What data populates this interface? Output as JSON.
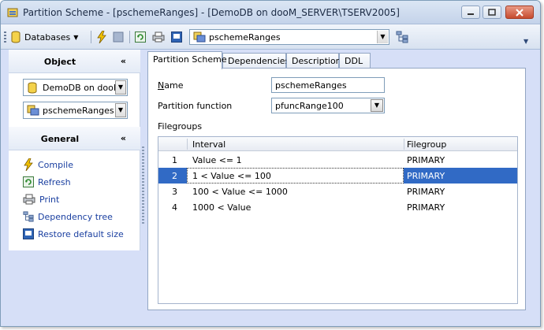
{
  "window": {
    "title": "Partition Scheme - [pschemeRanges] - [DemoDB on dooM_SERVER\\TSERV2005]",
    "controls": [
      "minimize",
      "restore",
      "close"
    ]
  },
  "toolbar": {
    "databases_label": "Databases",
    "object_combo_value": "pschemeRanges"
  },
  "left_panel": {
    "object_section": {
      "title": "Object",
      "database_value": "DemoDB on dooM_",
      "object_value": "pschemeRanges"
    },
    "general_section": {
      "title": "General",
      "links": [
        {
          "label": "Compile",
          "icon": "lightning-icon"
        },
        {
          "label": "Refresh",
          "icon": "refresh-icon"
        },
        {
          "label": "Print",
          "icon": "printer-icon"
        },
        {
          "label": "Dependency tree",
          "icon": "tree-icon"
        },
        {
          "label": "Restore default size",
          "icon": "restore-size-icon"
        }
      ]
    }
  },
  "tabs": [
    {
      "label": "Partition Scheme",
      "active": true
    },
    {
      "label": "Dependencies",
      "active": false
    },
    {
      "label": "Description",
      "active": false
    },
    {
      "label": "DDL",
      "active": false
    }
  ],
  "form": {
    "name_label_pre": "",
    "name_label_underlined": "N",
    "name_label_post": "ame",
    "name_value": "pschemeRanges",
    "partition_function_label": "Partition function",
    "partition_function_value": "pfuncRange100",
    "filegroups_label": "Filegroups"
  },
  "filegroups_grid": {
    "columns": [
      "Interval",
      "Filegroup"
    ],
    "rows": [
      {
        "num": "1",
        "interval": "Value <= 1",
        "filegroup": "PRIMARY",
        "selected": false
      },
      {
        "num": "2",
        "interval": "1 < Value <= 100",
        "filegroup": "PRIMARY",
        "selected": true
      },
      {
        "num": "3",
        "interval": "100 < Value <= 1000",
        "filegroup": "PRIMARY",
        "selected": false
      },
      {
        "num": "4",
        "interval": "1000 < Value",
        "filegroup": "PRIMARY",
        "selected": false
      }
    ]
  },
  "colors": {
    "selection": "#316ac5",
    "link": "#1a3fa0",
    "frame": "#d6dff7"
  }
}
